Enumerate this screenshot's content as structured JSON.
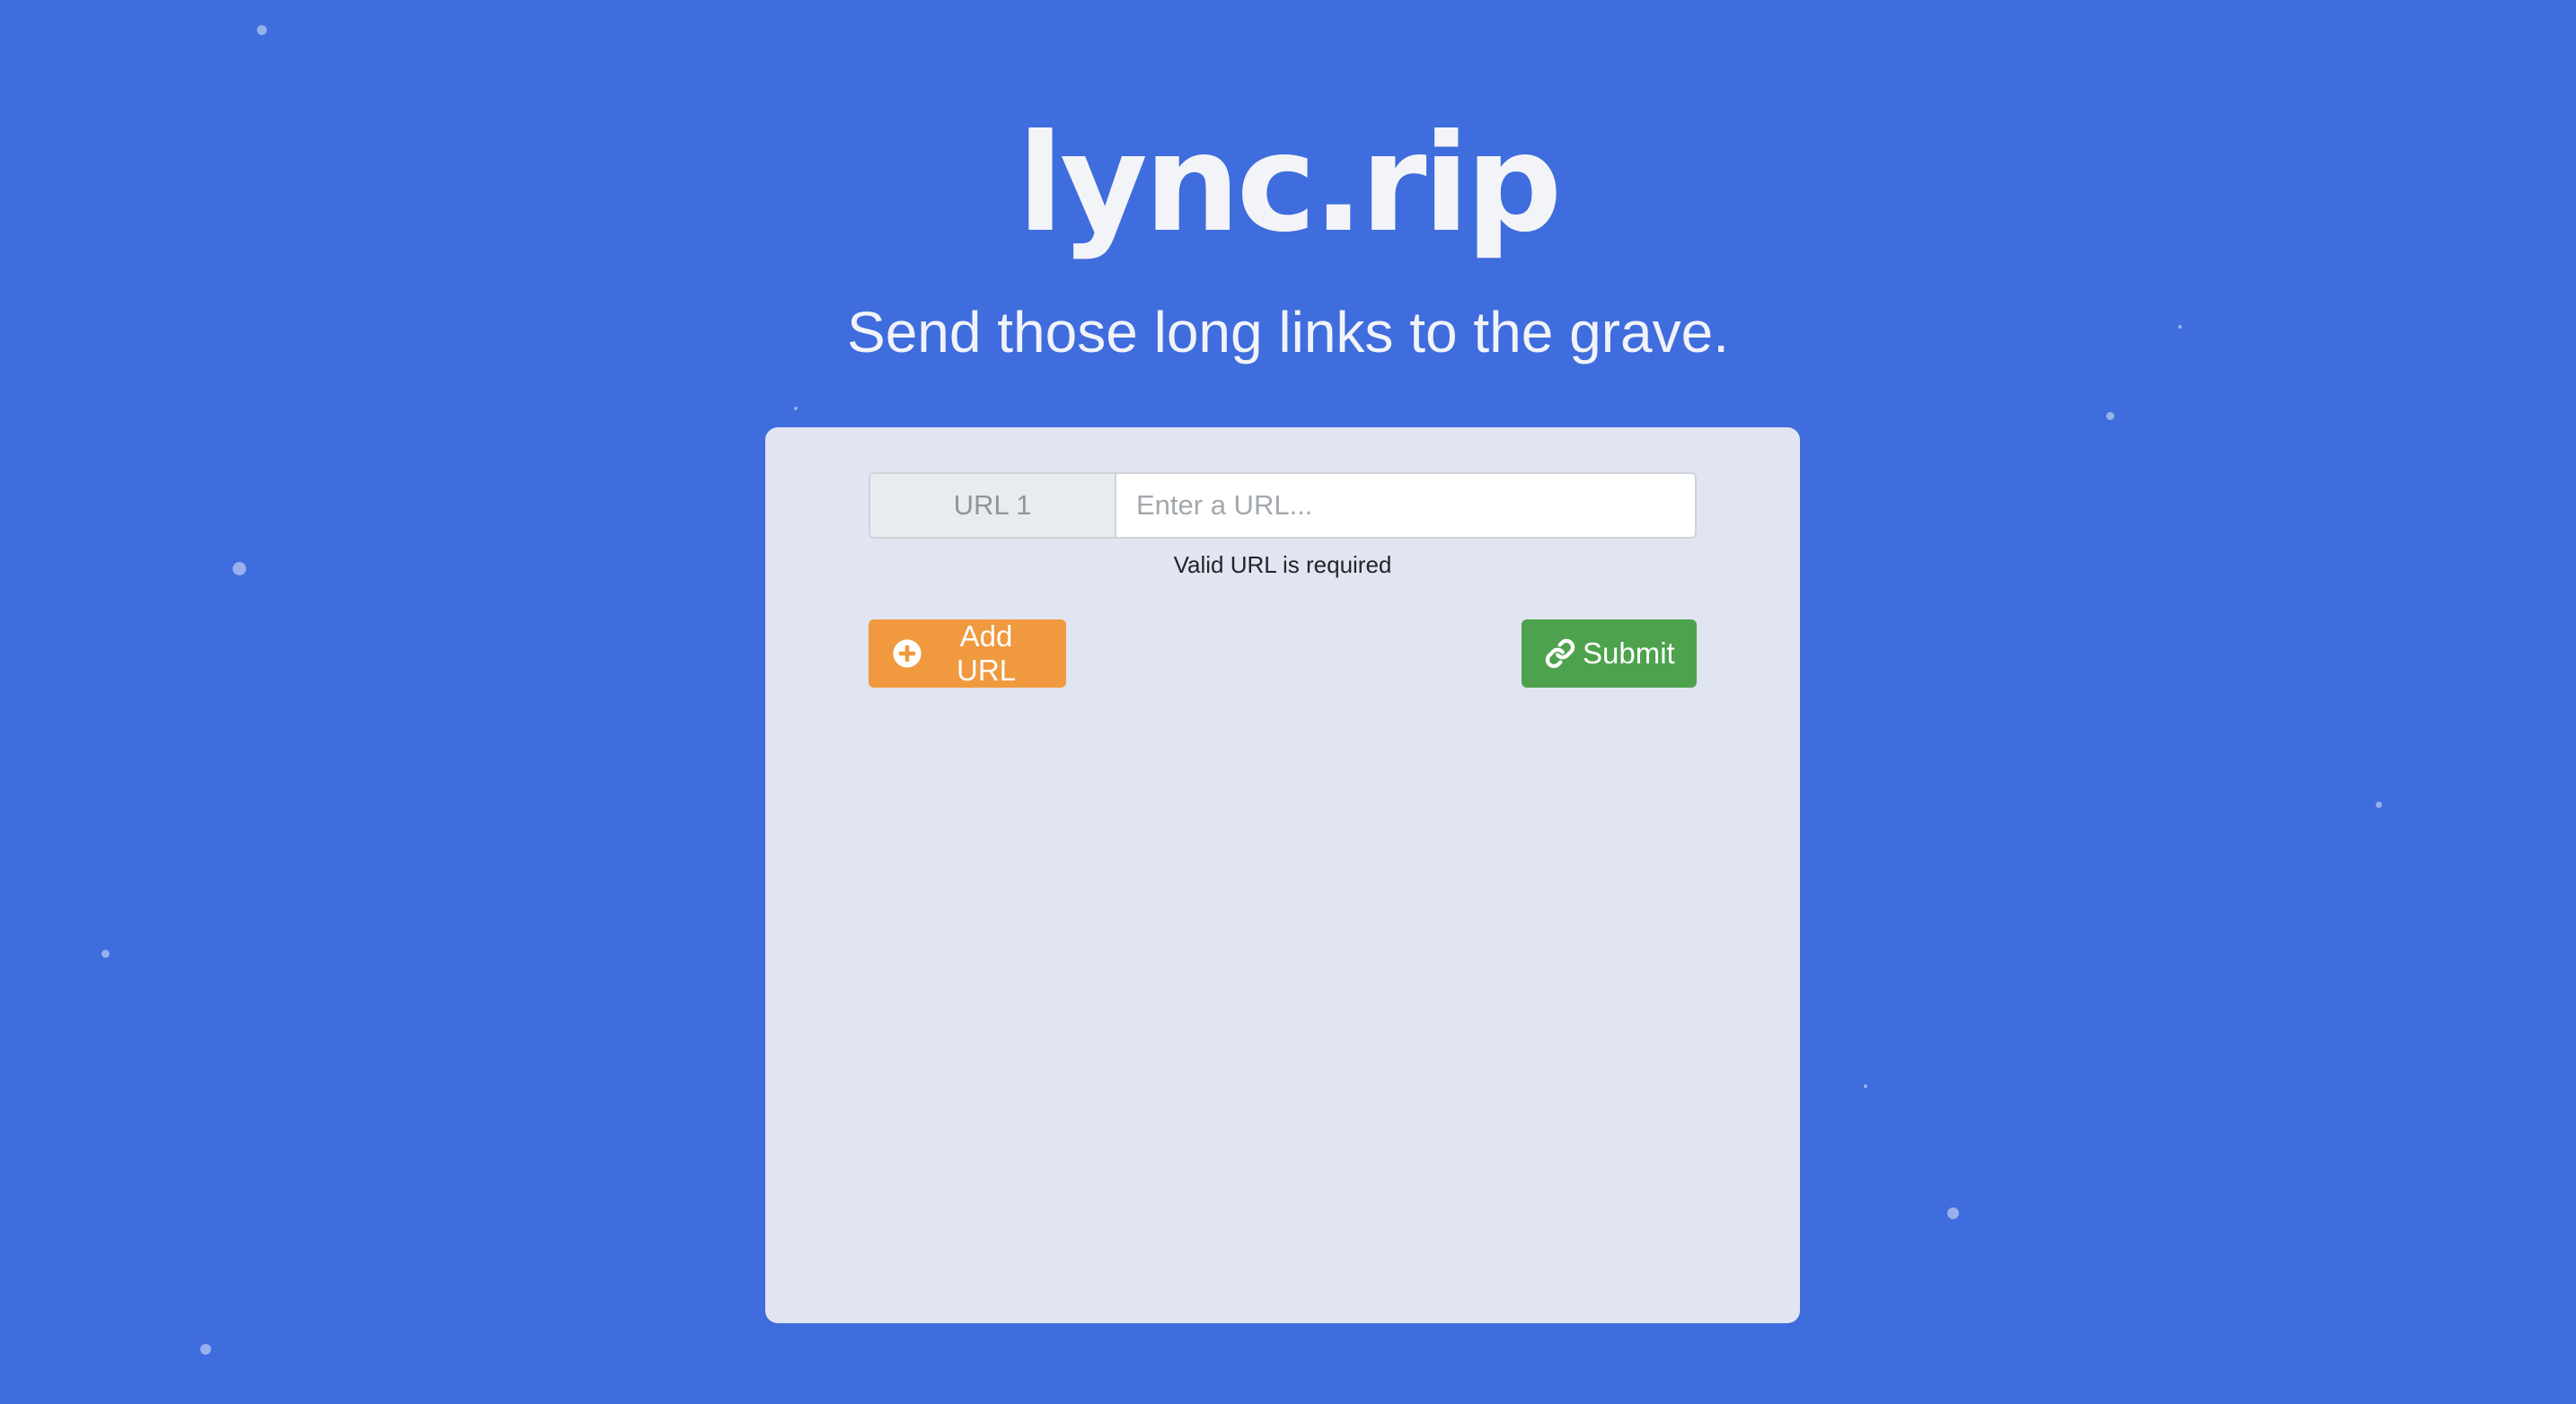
{
  "header": {
    "logo": "lync.rip",
    "tagline": "Send those long links to the grave."
  },
  "form": {
    "url_label": "URL 1",
    "url_placeholder": "Enter a URL...",
    "url_value": "",
    "validation_message": "Valid URL is required",
    "add_button_label": "Add URL",
    "add_button_icon": "plus-circle-icon",
    "submit_button_label": "Submit",
    "submit_button_icon": "link-icon"
  },
  "colors": {
    "background": "#3f6ddd",
    "card": "#e1e5f1",
    "add_button": "#f0993f",
    "submit_button": "#4ea24d"
  }
}
